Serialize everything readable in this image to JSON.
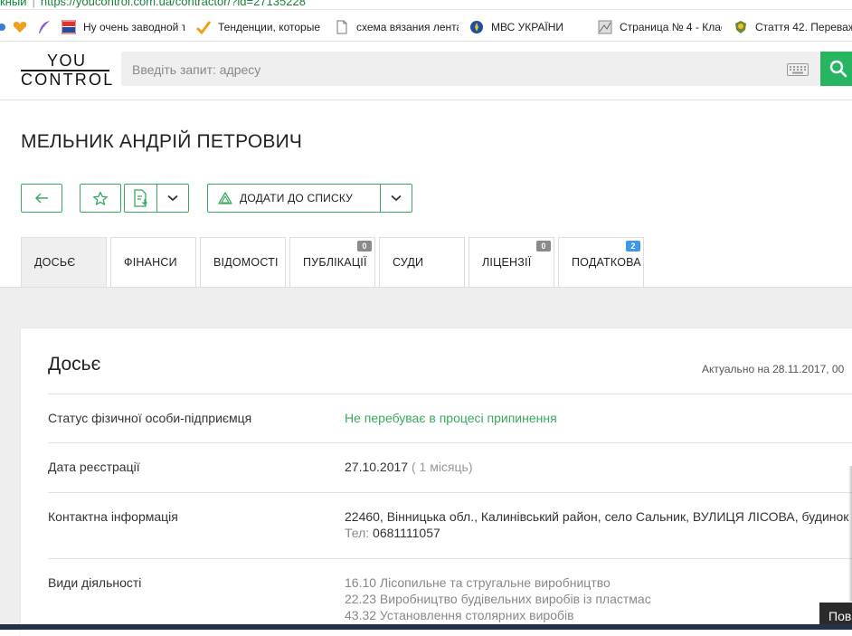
{
  "browser": {
    "url_prefix": "кный",
    "url": "https://youcontrol.com.ua/contractor/?id=27135228",
    "bookmarks": [
      {
        "label": "Ну очень заводной т",
        "icon": "mark-stuk-icon"
      },
      {
        "label": "Тенденции, которые",
        "icon": "check-icon"
      },
      {
        "label": "схема вязания лента",
        "icon": "page-icon"
      },
      {
        "label": "МВС УКРАЇНИ",
        "icon": "emblem-icon"
      },
      {
        "label": "Страница № 4 - Клас",
        "icon": "image-icon"
      },
      {
        "label": "Стаття 42. Переваж",
        "icon": "crest-icon"
      }
    ]
  },
  "header": {
    "logo_top": "YOU",
    "logo_bottom": "CONTROL",
    "search_placeholder": "Введіть запит: адресу"
  },
  "page": {
    "title": "МЕЛЬНИК АНДРІЙ ПЕТРОВИЧ"
  },
  "actions": {
    "add_to_list_label": "ДОДАТИ ДО СПИСКУ"
  },
  "tabs": [
    {
      "label": "ДОСЬЄ",
      "badge": null,
      "active": true
    },
    {
      "label": "ФІНАНСИ",
      "badge": null
    },
    {
      "label": "ВІДОМОСТІ",
      "badge": null
    },
    {
      "label": "ПУБЛІКАЦІЇ",
      "badge": "0"
    },
    {
      "label": "СУДИ",
      "badge": null
    },
    {
      "label": "ЛІЦЕНЗІЇ",
      "badge": "0"
    },
    {
      "label": "ПОДАТКОВА",
      "badge": "2"
    }
  ],
  "dossier": {
    "title": "Досьє",
    "updated": "Актуально на 28.11.2017, 00",
    "status_label": "Статус фізичної особи-підприємця",
    "status_value": "Не перебуває в процесі припинення",
    "reg_label": "Дата реєстрації",
    "reg_date": "27.10.2017",
    "reg_age": "( 1 місяць)",
    "contact_label": "Контактна інформація",
    "address": "22460, Вінницька обл., Калинівський район, село Сальник, ВУЛИЦЯ ЛІСОВА, будинок",
    "phone_label": "Тел:",
    "phone": "0681111057",
    "activity_label": "Види діяльності",
    "activities": [
      "16.10 Лісопильне та стругальне виробництво",
      "22.23 Виробництво будівельних виробів із пластмас",
      "43.32 Установлення столярних виробів"
    ]
  },
  "corner_label": "Пов",
  "colors": {
    "accent": "#26b662",
    "border_green": "#3aa85e",
    "badge_blue": "#3f97e6"
  }
}
